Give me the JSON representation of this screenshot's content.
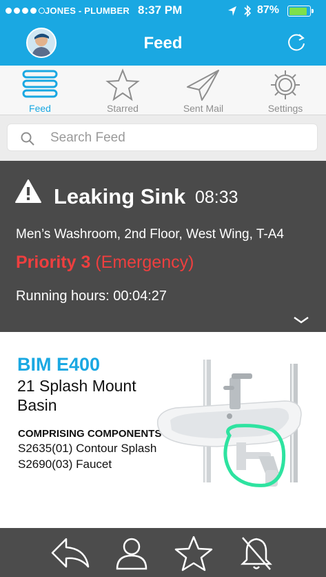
{
  "status_bar": {
    "carrier": "JONES - PLUMBER",
    "time": "8:37 PM",
    "battery_percent": "87%",
    "battery_level": 0.87,
    "signal_bars_filled": 4,
    "signal_bars_total": 5
  },
  "header": {
    "title": "Feed",
    "avatar_icon": "user-avatar",
    "refresh_icon": "refresh-icon",
    "accent_color": "#1aa8e2"
  },
  "tabs": [
    {
      "label": "Feed",
      "icon": "feed-lines-icon",
      "active": true
    },
    {
      "label": "Starred",
      "icon": "star-icon",
      "active": false
    },
    {
      "label": "Sent Mail",
      "icon": "paper-plane-icon",
      "active": false
    },
    {
      "label": "Settings",
      "icon": "gear-icon",
      "active": false
    }
  ],
  "search": {
    "placeholder": "Search Feed",
    "value": ""
  },
  "alert": {
    "title": "Leaking Sink",
    "time": "08:33",
    "location": "Men’s Washroom, 2nd Floor, West Wing, T-A4",
    "priority_label": "Priority 3",
    "priority_detail": "(Emergency)",
    "priority_color": "#ee3f3f",
    "running_hours": "Running hours:  00:04:27",
    "background_color": "#4a4a4a"
  },
  "product": {
    "name": "BIM E400",
    "description": "21 Splash Mount Basin",
    "components_heading": "COMPRISING COMPONENTS",
    "components": [
      "S2635(01) Contour Splash",
      "S2690(03) Faucet"
    ],
    "highlight_color": "#2ee3a0"
  },
  "bottom_bar": {
    "icons": [
      "reply-icon",
      "user-icon",
      "star-icon",
      "bell-off-icon"
    ]
  }
}
